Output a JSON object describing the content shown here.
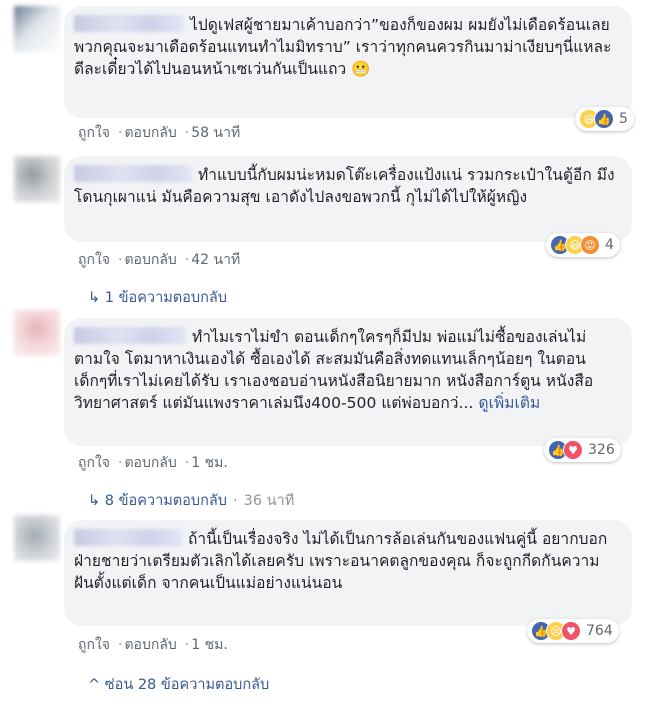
{
  "comments": [
    {
      "text": "ไปดูเฟสผู้ชายมาเค้าบอกว่า”ของก็ของผม ผมยังไม่เดือดร้อนเลยพวกคุณจะมาเดือดร้อนแทนทำไมมิทราบ” เราว่าทุกคนควรกินมาม่าเงียบๆนี่แหละดีละเดี๋ยวได้ไปนอนหน้าเซเว่นกันเป็นแถว",
      "emoji": "😬",
      "like": "ถูกใจ",
      "reply": "ตอบกลับ",
      "time": "58 นาที",
      "reaction_count": "5",
      "reaction_icons": [
        "haha",
        "like"
      ]
    },
    {
      "text": "ทำแบบนี้กับผมน่ะหมดโต๊ะเครื่องแป้งแน่ รวมกระเป๋าในตู้อีก มึงโดนกุเผาแน่ มันคือความสุข เอาดังไปลงขอพวกนี้ กุไม่ได้ไปให้ผู้หญิง",
      "like": "ถูกใจ",
      "reply": "ตอบกลับ",
      "time": "42 นาที",
      "reaction_count": "4",
      "reaction_icons": [
        "like",
        "haha",
        "angry"
      ],
      "replies_label": "1 ข้อความตอบกลับ"
    },
    {
      "text": "ทำไมเราไม่ขำ ตอนเด็กๆใครๆก็มีปม พ่อแม่ไม่ซื้อของเล่นไม่ตามใจ โตมาหาเงินเองได้ ซื้อเองได้ สะสมมันคือสิ่งทดแทนเล็กๆน้อยๆ ในตอนเด็กๆที่เราไม่เคยได้รับ เราเองชอบอ่านหนังสือนิยายมาก หนังสือการ์ตูน หนังสือวิทยาศาสตร์ แต่มันแพงราคาเล่มนึง400-500 แต่พ่อบอกว่...",
      "see_more": "ดูเพิ่มเติม",
      "like": "ถูกใจ",
      "reply": "ตอบกลับ",
      "time": "1 ชม.",
      "reaction_count": "326",
      "reaction_icons": [
        "like",
        "love"
      ],
      "replies_label": "8 ข้อความตอบกลับ",
      "replies_time": "36 นาที"
    },
    {
      "text": "ถ้านี้เป็นเรื่องจริง ไม่ได้เป็นการล้อเล่นกันของแฟนคู่นี้ อยากบอกฝ่ายชายว่าเตรียมตัวเลิกได้เลยครับ เพราะอนาคตลูกของคุณ ก็จะถูกกีดกันความฝันตั้งแต่เด็ก จากคนเป็นแม่อย่างแน่นอน",
      "like": "ถูกใจ",
      "reply": "ตอบกลับ",
      "time": "1 ชม.",
      "reaction_count": "764",
      "reaction_icons": [
        "like",
        "sad",
        "love"
      ],
      "replies_label": "ซ่อน 28 ข้อความตอบกลับ"
    }
  ],
  "colors": {
    "link": "#365899",
    "bubble": "#f2f3f5",
    "meta": "#606770",
    "like": "#4267b2",
    "love": "#f25268",
    "haha": "#fbd14b",
    "angry": "#f28f33"
  }
}
